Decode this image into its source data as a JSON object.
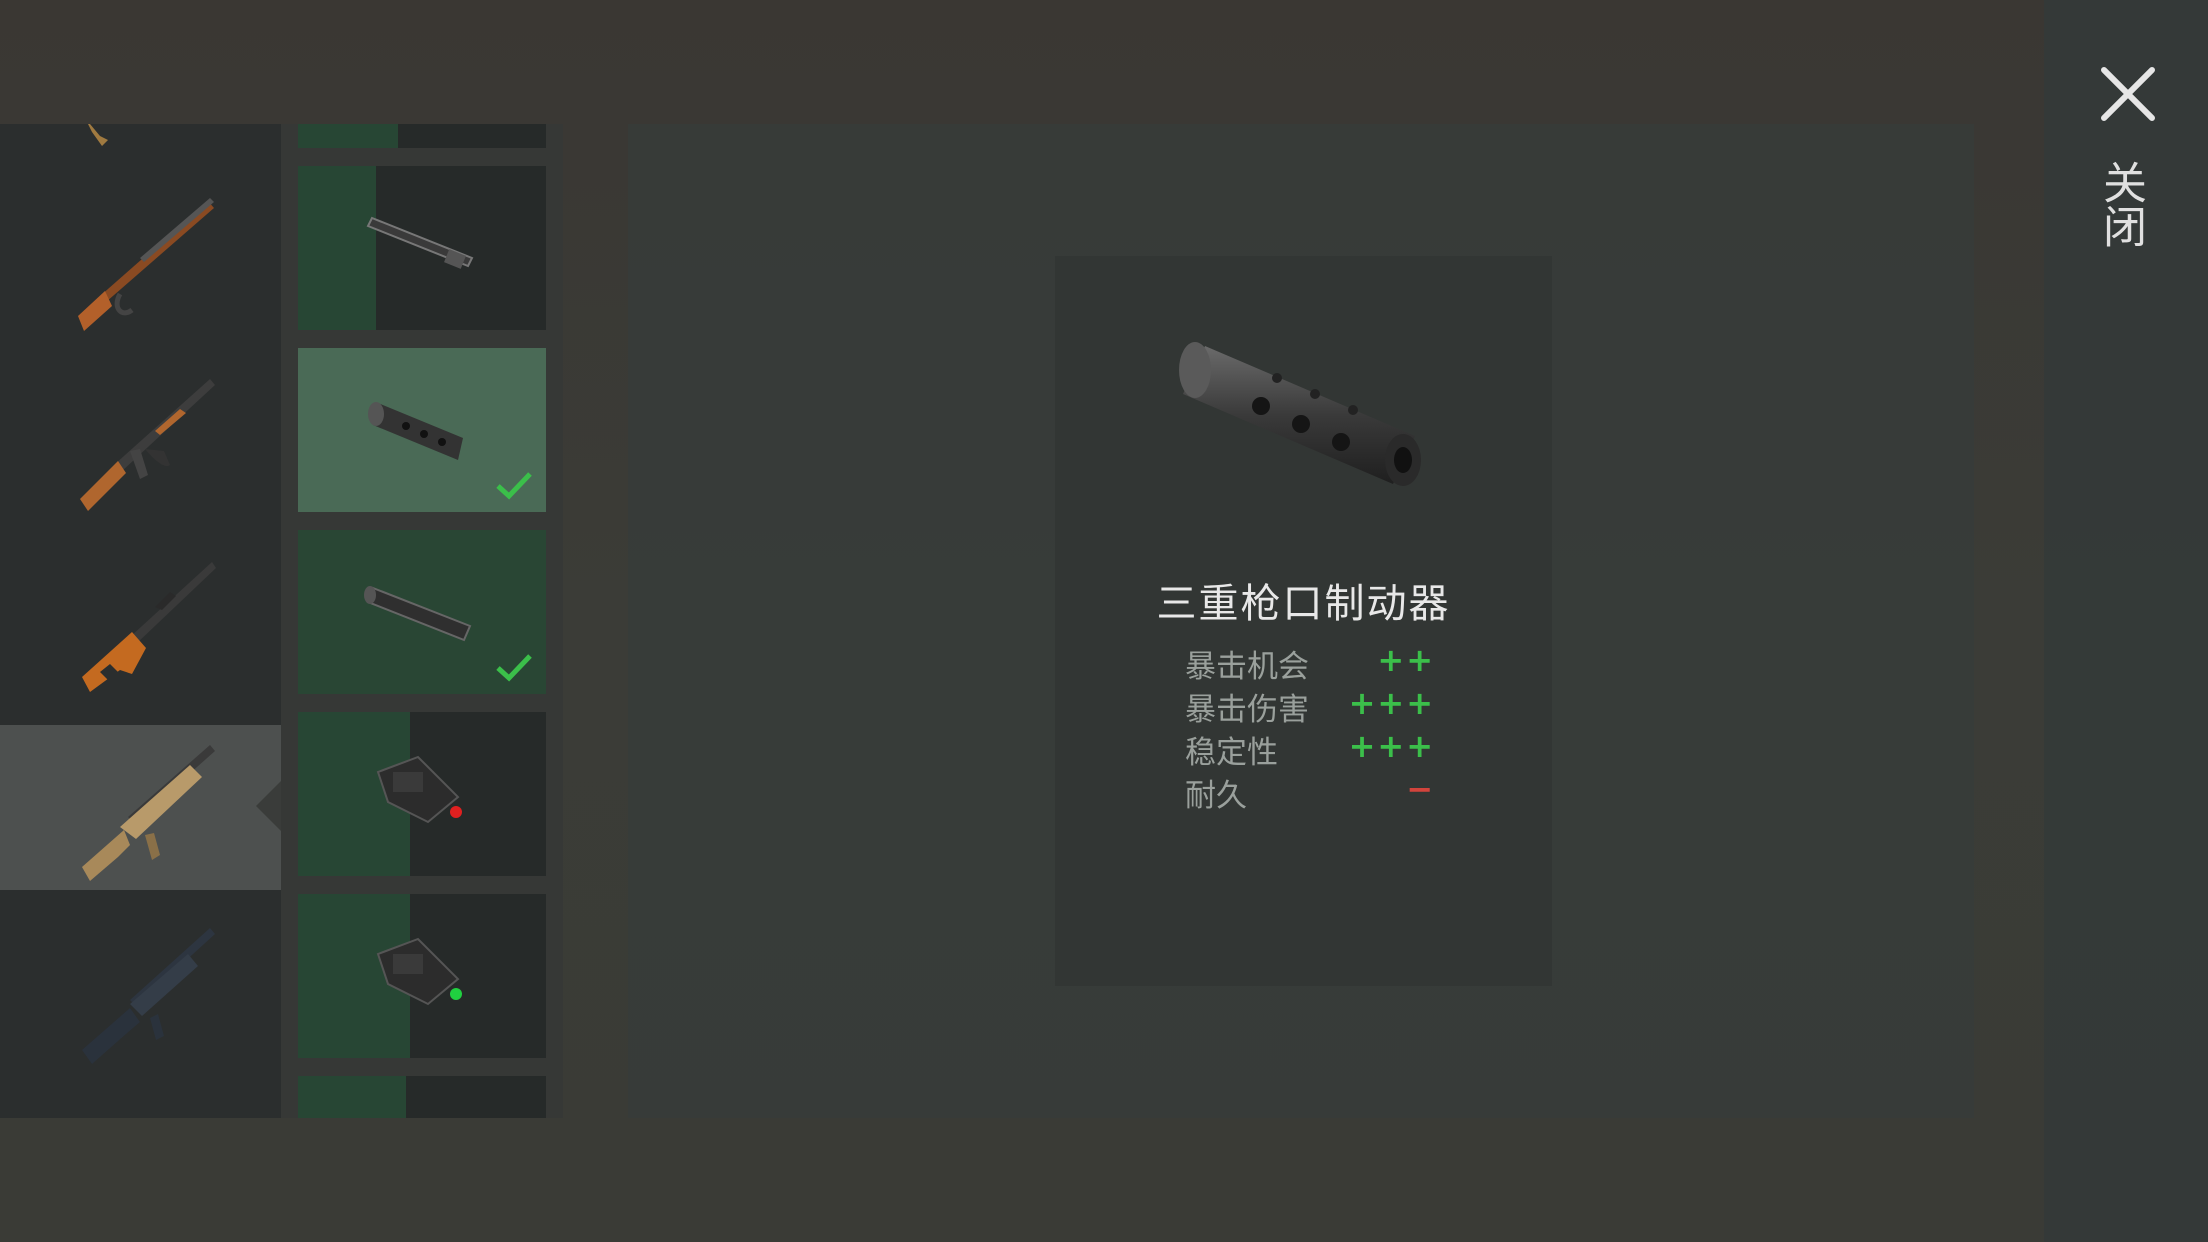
{
  "weapons": [
    {
      "icon": "lever-action-rifle-icon"
    },
    {
      "icon": "ak47-rifle-icon"
    },
    {
      "icon": "sniper-rifle-icon"
    },
    {
      "icon": "scar-rifle-icon",
      "selected": true
    },
    {
      "icon": "m16-rifle-icon"
    }
  ],
  "attachments": [
    {
      "icon": "barrel-rod-icon"
    },
    {
      "icon": "triple-muzzle-brake-icon",
      "equipped": true,
      "selected": true
    },
    {
      "icon": "suppressor-icon",
      "equipped": true
    },
    {
      "icon": "red-laser-sight-icon"
    },
    {
      "icon": "green-laser-sight-icon"
    }
  ],
  "detail": {
    "name": "三重枪口制动器",
    "stats": [
      {
        "label": "暴击机会",
        "value": "++",
        "type": "positive"
      },
      {
        "label": "暴击伤害",
        "value": "+++",
        "type": "positive"
      },
      {
        "label": "稳定性",
        "value": "+++",
        "type": "positive"
      },
      {
        "label": "耐久",
        "value": "−",
        "type": "negative"
      }
    ]
  },
  "close_label": "关闭",
  "colors": {
    "positive": "#3bbf4a",
    "negative": "#d2443c",
    "selected_slot": "#4a6a56"
  }
}
